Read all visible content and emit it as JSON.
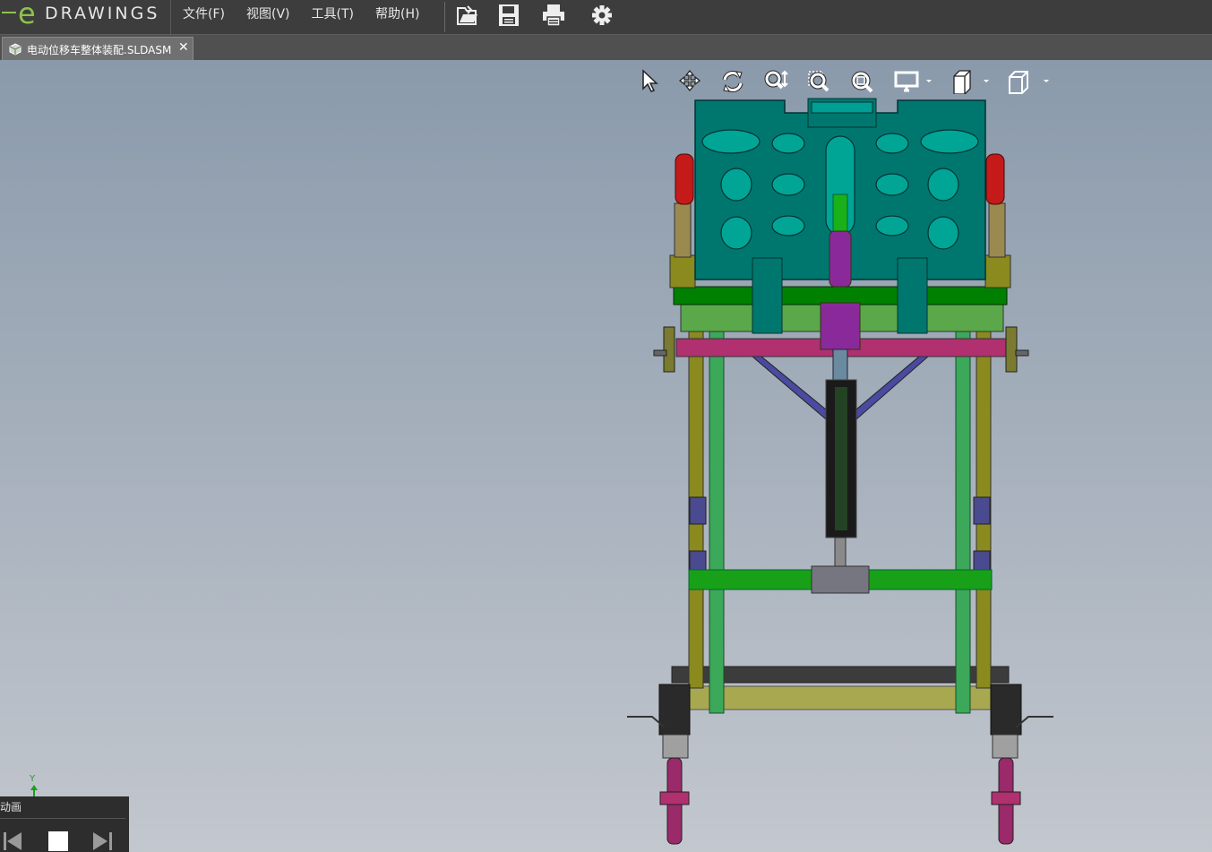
{
  "app": {
    "logo_letter": "e",
    "logo_text": "DRAWINGS"
  },
  "menu": [
    {
      "label": "文件(F)"
    },
    {
      "label": "视图(V)"
    },
    {
      "label": "工具(T)"
    },
    {
      "label": "帮助(H)"
    }
  ],
  "toolbar": [
    "open-icon",
    "save-icon",
    "print-icon",
    "settings-icon"
  ],
  "tab": {
    "label": "电动位移车整体装配.SLDASM",
    "close": "✕"
  },
  "heads_up_toolbar": [
    "select-icon",
    "pan-icon",
    "rotate-icon",
    "zoom-icon",
    "zoom-to-area-icon",
    "zoom-to-fit-icon",
    "display-style-icon",
    "section-icon",
    "view-orientation-icon"
  ],
  "triad": {
    "axis_label": "Y"
  },
  "animation_panel": {
    "title": "动画",
    "controls": [
      "first-frame-icon",
      "stop-icon",
      "last-frame-icon"
    ]
  },
  "colors": {
    "frame_teal": "#00776e",
    "frame_green": "#008000",
    "rail_olive": "#8a8a1e",
    "post_green": "#3ca85a",
    "crossbar_magenta": "#b03070",
    "actuator_purple": "#8a2a9a",
    "brace_blue": "#4a4aa0",
    "handle_red": "#c41a1a",
    "wheel_magenta": "#9a2a6a"
  }
}
